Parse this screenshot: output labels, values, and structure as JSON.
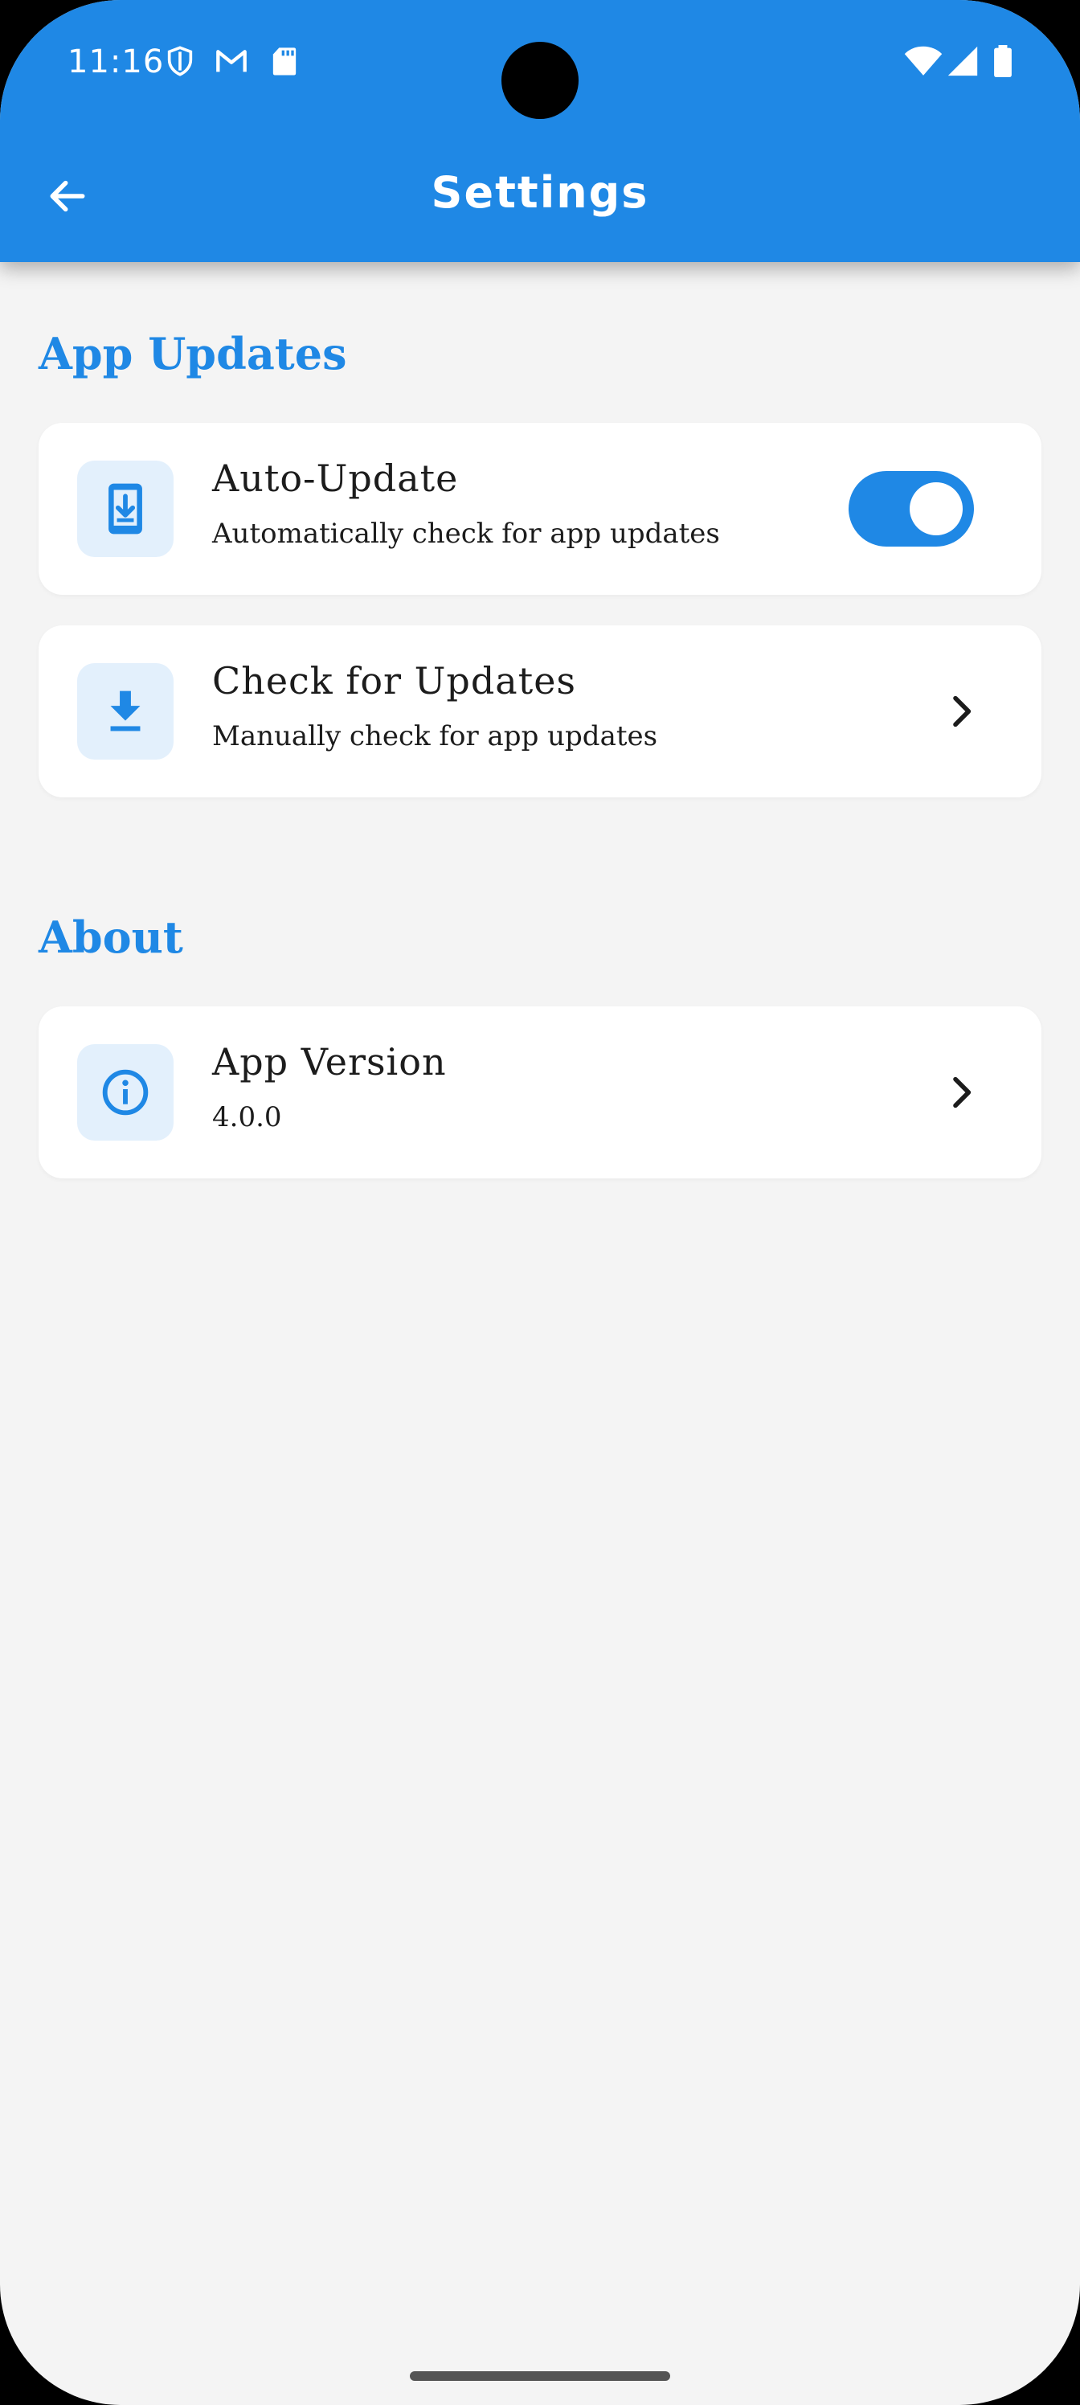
{
  "status_bar": {
    "time": "11:16",
    "left_icons": [
      "shield-icon",
      "gmail-icon",
      "sd-card-icon"
    ],
    "right_icons": [
      "wifi-icon",
      "signal-icon",
      "battery-icon"
    ]
  },
  "app_bar": {
    "title": "Settings",
    "back_icon": "arrow-back-icon",
    "background_color": "#1f88e5"
  },
  "sections": {
    "app_updates": {
      "title": "App Updates",
      "auto_update": {
        "title": "Auto-Update",
        "subtitle": "Automatically check for app updates",
        "icon": "phone-download-icon",
        "toggle_on": true
      },
      "check_updates": {
        "title": "Check for Updates",
        "subtitle": "Manually check for app updates",
        "icon": "download-icon"
      }
    },
    "about": {
      "title": "About",
      "app_version": {
        "title": "App Version",
        "value": "4.0.0",
        "icon": "info-icon"
      }
    }
  },
  "colors": {
    "accent": "#1f88e5",
    "background": "#f4f4f4",
    "card": "#ffffff",
    "icon_tile": "#e3f0fc"
  }
}
